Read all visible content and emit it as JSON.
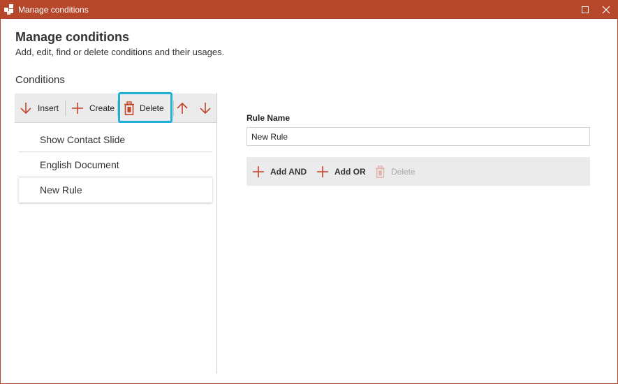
{
  "window": {
    "title": "Manage conditions",
    "accent_color": "#b7472a",
    "highlight_color": "#1fb2d6",
    "controls": {
      "maximize": "maximize-icon",
      "close": "close-icon"
    }
  },
  "header": {
    "title": "Manage conditions",
    "subtitle": "Add, edit, find or delete conditions and their usages."
  },
  "conditions": {
    "section_label": "Conditions",
    "toolbar": {
      "insert_label": "Insert",
      "create_label": "Create",
      "delete_label": "Delete",
      "icons": [
        "arrow-down-icon",
        "plus-icon",
        "trash-icon",
        "arrow-up-icon",
        "arrow-down-icon"
      ]
    },
    "items": [
      {
        "label": "Show Contact Slide"
      },
      {
        "label": "English Document"
      },
      {
        "label": "New Rule",
        "selected": true
      }
    ]
  },
  "rule": {
    "name_label": "Rule Name",
    "name_value": "New Rule",
    "actions": {
      "add_and_label": "Add AND",
      "add_or_label": "Add OR",
      "delete_label": "Delete",
      "delete_disabled": true
    }
  }
}
